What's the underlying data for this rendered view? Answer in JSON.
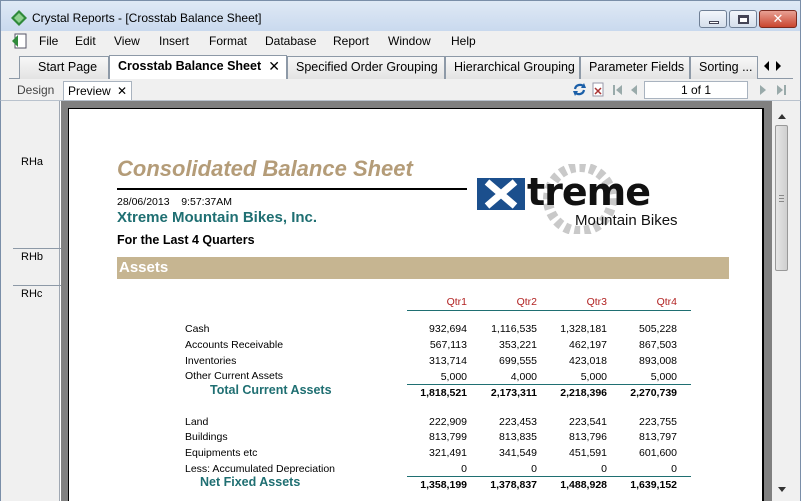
{
  "window": {
    "title": "Crystal Reports - [Crosstab Balance Sheet]"
  },
  "menu": [
    "File",
    "Edit",
    "View",
    "Insert",
    "Format",
    "Database",
    "Report",
    "Window",
    "Help"
  ],
  "tabs": [
    {
      "label": "Start Page"
    },
    {
      "label": "Crosstab Balance Sheet",
      "active": true
    },
    {
      "label": "Specified Order Grouping"
    },
    {
      "label": "Hierarchical Grouping"
    },
    {
      "label": "Parameter Fields"
    },
    {
      "label": "Sorting ..."
    }
  ],
  "view_tabs": {
    "design": "Design",
    "preview": "Preview"
  },
  "pager": {
    "text": "1 of 1"
  },
  "sections": [
    "RHa",
    "RHb",
    "RHc"
  ],
  "report": {
    "title": "Consolidated Balance Sheet",
    "datetime": "28/06/2013    9:57:37AM",
    "company": "Xtreme Mountain Bikes, Inc.",
    "period": "For the Last 4 Quarters",
    "logo_main": "treme",
    "logo_sub": "Mountain Bikes",
    "section_header": "Assets",
    "columns": [
      "Qtr1",
      "Qtr2",
      "Qtr3",
      "Qtr4"
    ],
    "current_assets": [
      {
        "label": "Cash",
        "values": [
          "932,694",
          "1,116,535",
          "1,328,181",
          "505,228"
        ]
      },
      {
        "label": "Accounts Receivable",
        "values": [
          "567,113",
          "353,221",
          "462,197",
          "867,503"
        ]
      },
      {
        "label": "Inventories",
        "values": [
          "313,714",
          "699,555",
          "423,018",
          "893,008"
        ]
      },
      {
        "label": "Other Current Assets",
        "values": [
          "5,000",
          "4,000",
          "5,000",
          "5,000"
        ]
      }
    ],
    "total_current": {
      "label": "Total Current Assets",
      "values": [
        "1,818,521",
        "2,173,311",
        "2,218,396",
        "2,270,739"
      ]
    },
    "fixed_assets": [
      {
        "label": "Land",
        "values": [
          "222,909",
          "223,453",
          "223,541",
          "223,755"
        ]
      },
      {
        "label": "Buildings",
        "values": [
          "813,799",
          "813,835",
          "813,796",
          "813,797"
        ]
      },
      {
        "label": "Equipments etc",
        "values": [
          "321,491",
          "341,549",
          "451,591",
          "601,600"
        ]
      },
      {
        "label": "Less: Accumulated Depreciation",
        "values": [
          "0",
          "0",
          "0",
          "0"
        ]
      }
    ],
    "total_fixed": {
      "label": "Net Fixed Assets",
      "values": [
        "1,358,199",
        "1,378,837",
        "1,488,928",
        "1,639,152"
      ]
    }
  }
}
